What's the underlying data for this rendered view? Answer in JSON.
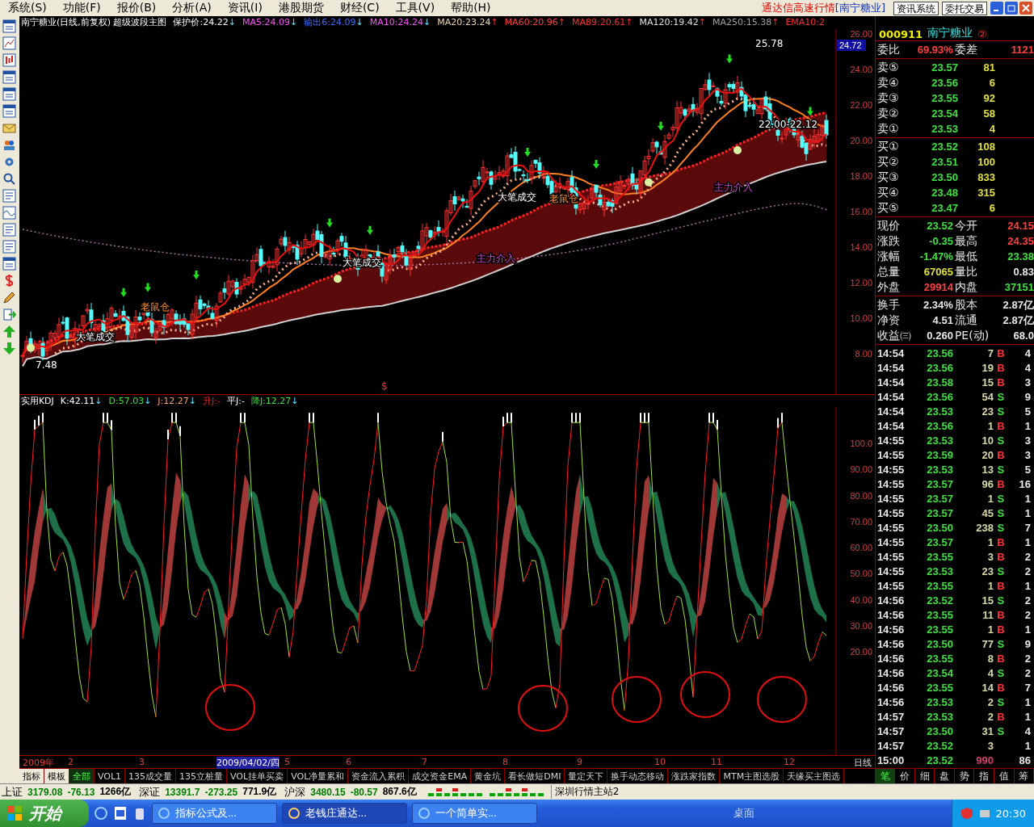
{
  "menu": [
    "系统(S)",
    "功能(F)",
    "报价(B)",
    "分析(A)",
    "资讯(I)",
    "港股期货",
    "财经(C)",
    "工具(V)",
    "帮助(H)"
  ],
  "header": {
    "status": "通达信高速行情",
    "stock": "[南宁糖业]",
    "buttons": [
      "资讯系统",
      "委托交易"
    ]
  },
  "price_pane": {
    "title": "南宁糖业(日线,前复权) 超级波段主图",
    "indicators": [
      {
        "label": "保护价:24.22",
        "arrow": "↓",
        "rising": false,
        "color": "#ffffff"
      },
      {
        "label": "MA5:24.09",
        "arrow": "↓",
        "rising": false,
        "color": "#ff50ff"
      },
      {
        "label": "输出6:24.09",
        "arrow": "↓",
        "rising": false,
        "color": "#3c6cff"
      },
      {
        "label": "MA10:24.24",
        "arrow": "↓",
        "rising": false,
        "color": "#ff50ff"
      },
      {
        "label": "MA20:23.24",
        "arrow": "↑",
        "rising": true,
        "color": "#f0d8b0"
      },
      {
        "label": "MA60:20.96",
        "arrow": "↑",
        "rising": true,
        "color": "#ff4040"
      },
      {
        "label": "MA89:20.61",
        "arrow": "↑",
        "rising": true,
        "color": "#ff3030"
      },
      {
        "label": "MA120:19.42",
        "arrow": "↑",
        "rising": true,
        "color": "#e0e0e0"
      },
      {
        "label": "MA250:15.38",
        "arrow": "↑",
        "rising": true,
        "color": "#a0a0a0"
      },
      {
        "label": "EMA10:2",
        "color": "#ff3030"
      }
    ],
    "axis": [
      "26.00",
      "24.00",
      "22.00",
      "20.00",
      "18.00",
      "16.00",
      "14.00",
      "12.00",
      "10.00",
      "8.00"
    ],
    "current_price": "24.72",
    "annotations": [
      {
        "text": "25.78",
        "kind": "price"
      },
      {
        "text": "22.00-22.12",
        "kind": "price"
      },
      {
        "text": "7.48",
        "kind": "price"
      },
      {
        "text": "大笔成交",
        "kind": "big_trade"
      },
      {
        "text": "大笔成交",
        "kind": "big_trade"
      },
      {
        "text": "大笔成交",
        "kind": "big_trade"
      },
      {
        "text": "老鼠仓",
        "kind": "rat"
      },
      {
        "text": "老鼠仓",
        "kind": "rat"
      },
      {
        "text": "主力介入",
        "kind": "main"
      },
      {
        "text": "主力介入",
        "kind": "main"
      },
      {
        "text": "$",
        "kind": "marker"
      }
    ]
  },
  "kdj_pane": {
    "indicators": [
      {
        "label": "实用KDJ"
      },
      {
        "label": "K:42.11",
        "arrow": "↓",
        "rising": false
      },
      {
        "label": "D:57.03",
        "arrow": "↓",
        "rising": false,
        "color": "#40e040"
      },
      {
        "label": "J:12.27",
        "arrow": "↓",
        "rising": false,
        "color": "#f0a070"
      },
      {
        "label": "升J:-",
        "color": "#e02020"
      },
      {
        "label": "平J:-"
      },
      {
        "label": "降J:12.27",
        "arrow": "↓",
        "rising": false,
        "color": "#40e040"
      }
    ],
    "axis": [
      "100.0",
      "90.00",
      "80.00",
      "70.00",
      "60.00",
      "50.00",
      "40.00",
      "30.00",
      "20.00"
    ]
  },
  "date_axis": {
    "labels": [
      {
        "text": "2009年",
        "selected": false
      },
      {
        "text": "2",
        "selected": false
      },
      {
        "text": "3",
        "selected": false
      },
      {
        "text": "2009/04/02/四",
        "selected": true
      },
      {
        "text": "5",
        "selected": false
      },
      {
        "text": "6",
        "selected": false
      },
      {
        "text": "7",
        "selected": false
      },
      {
        "text": "8",
        "selected": false
      },
      {
        "text": "9",
        "selected": false
      },
      {
        "text": "10",
        "selected": false
      },
      {
        "text": "11",
        "selected": false
      },
      {
        "text": "12",
        "selected": false
      }
    ],
    "period": "日线"
  },
  "mode_buttons": [
    "指标",
    "模板"
  ],
  "tabs": [
    {
      "label": "全部",
      "selected": true
    },
    {
      "label": "VOL1",
      "selected": false
    },
    {
      "label": "135成交量",
      "selected": false
    },
    {
      "label": "135立桩量",
      "selected": false
    },
    {
      "label": "VOL挂单买卖",
      "selected": false
    },
    {
      "label": "VOL净量累和",
      "selected": false
    },
    {
      "label": "资金流入累积",
      "selected": false
    },
    {
      "label": "成交资金EMA",
      "selected": false
    },
    {
      "label": "黄金坑",
      "selected": false
    },
    {
      "label": "看长做短DMI",
      "selected": false
    },
    {
      "label": "量定天下",
      "selected": false
    },
    {
      "label": "换手动态移动",
      "selected": false
    },
    {
      "label": "涨跌家指数",
      "selected": false
    },
    {
      "label": "MTM主图选股",
      "selected": false
    },
    {
      "label": "天缘买主图选",
      "selected": false
    }
  ],
  "quote": {
    "code": "000911",
    "name": "南宁糖业",
    "badge": "②",
    "ratio": {
      "label": "委比",
      "value": "69.93%",
      "label2": "委差",
      "value2": "1121"
    },
    "asks": [
      {
        "label": "卖⑤",
        "price": "23.57",
        "volume": "81"
      },
      {
        "label": "卖④",
        "price": "23.56",
        "volume": "6"
      },
      {
        "label": "卖③",
        "price": "23.55",
        "volume": "92"
      },
      {
        "label": "卖②",
        "price": "23.54",
        "volume": "58"
      },
      {
        "label": "卖①",
        "price": "23.53",
        "volume": "4"
      }
    ],
    "bids": [
      {
        "label": "买①",
        "price": "23.52",
        "volume": "108"
      },
      {
        "label": "买②",
        "price": "23.51",
        "volume": "100"
      },
      {
        "label": "买③",
        "price": "23.50",
        "volume": "833"
      },
      {
        "label": "买④",
        "price": "23.48",
        "volume": "315"
      },
      {
        "label": "买⑤",
        "price": "23.47",
        "volume": "6"
      }
    ],
    "stats": [
      {
        "label": "现价",
        "value": "23.52",
        "color": "#40e040"
      },
      {
        "label": "今开",
        "value": "24.15",
        "color": "#ff4040"
      },
      {
        "label": "涨跌",
        "value": "-0.35",
        "color": "#40e040"
      },
      {
        "label": "最高",
        "value": "24.35",
        "color": "#ff4040"
      },
      {
        "label": "涨幅",
        "value": "-1.47%",
        "color": "#40e040"
      },
      {
        "label": "最低",
        "value": "23.38",
        "color": "#40e040"
      },
      {
        "label": "总量",
        "value": "67065",
        "color": "#e0e040"
      },
      {
        "label": "量比",
        "value": "0.83",
        "color": "#e8e8e8"
      },
      {
        "label": "外盘",
        "value": "29914",
        "color": "#ff4040"
      },
      {
        "label": "内盘",
        "value": "37151",
        "color": "#40e040"
      }
    ],
    "finance": [
      {
        "label": "换手",
        "value": "2.34%",
        "label2": "股本",
        "value2": "2.87亿"
      },
      {
        "label": "净资",
        "value": "4.51",
        "label2": "流通",
        "value2": "2.87亿"
      },
      {
        "label": "收益㈢",
        "value": "0.260",
        "label2": "PE(动)",
        "value2": "68.0"
      }
    ]
  },
  "ticks": [
    {
      "time": "14:54",
      "price": "23.56",
      "volume": "7",
      "side": "B",
      "kind": "buy",
      "count": "4",
      "large": false
    },
    {
      "time": "14:54",
      "price": "23.56",
      "volume": "19",
      "side": "B",
      "kind": "buy",
      "count": "4",
      "large": false
    },
    {
      "time": "14:54",
      "price": "23.58",
      "volume": "15",
      "side": "B",
      "kind": "buy",
      "count": "3",
      "large": false
    },
    {
      "time": "14:54",
      "price": "23.56",
      "volume": "54",
      "side": "S",
      "kind": "sell",
      "count": "9",
      "large": false
    },
    {
      "time": "14:54",
      "price": "23.53",
      "volume": "23",
      "side": "S",
      "kind": "sell",
      "count": "5",
      "large": false
    },
    {
      "time": "14:54",
      "price": "23.56",
      "volume": "1",
      "side": "B",
      "kind": "buy",
      "count": "1",
      "large": false
    },
    {
      "time": "14:55",
      "price": "23.53",
      "volume": "10",
      "side": "S",
      "kind": "sell",
      "count": "3",
      "large": false
    },
    {
      "time": "14:55",
      "price": "23.59",
      "volume": "20",
      "side": "B",
      "kind": "buy",
      "count": "3",
      "large": false
    },
    {
      "time": "14:55",
      "price": "23.53",
      "volume": "13",
      "side": "S",
      "kind": "sell",
      "count": "5",
      "large": false
    },
    {
      "time": "14:55",
      "price": "23.57",
      "volume": "96",
      "side": "B",
      "kind": "buy",
      "count": "16",
      "large": false
    },
    {
      "time": "14:55",
      "price": "23.57",
      "volume": "1",
      "side": "S",
      "kind": "sell",
      "count": "1",
      "large": false
    },
    {
      "time": "14:55",
      "price": "23.57",
      "volume": "45",
      "side": "S",
      "kind": "sell",
      "count": "1",
      "large": false
    },
    {
      "time": "14:55",
      "price": "23.50",
      "volume": "238",
      "side": "S",
      "kind": "sell",
      "count": "7",
      "large": false
    },
    {
      "time": "14:55",
      "price": "23.57",
      "volume": "1",
      "side": "B",
      "kind": "buy",
      "count": "1",
      "large": false
    },
    {
      "time": "14:55",
      "price": "23.55",
      "volume": "3",
      "side": "B",
      "kind": "buy",
      "count": "2",
      "large": false
    },
    {
      "time": "14:55",
      "price": "23.53",
      "volume": "23",
      "side": "S",
      "kind": "sell",
      "count": "2",
      "large": false
    },
    {
      "time": "14:55",
      "price": "23.55",
      "volume": "1",
      "side": "B",
      "kind": "buy",
      "count": "1",
      "large": false
    },
    {
      "time": "14:56",
      "price": "23.52",
      "volume": "15",
      "side": "S",
      "kind": "sell",
      "count": "2",
      "large": false
    },
    {
      "time": "14:56",
      "price": "23.55",
      "volume": "11",
      "side": "B",
      "kind": "buy",
      "count": "2",
      "large": false
    },
    {
      "time": "14:56",
      "price": "23.55",
      "volume": "1",
      "side": "B",
      "kind": "buy",
      "count": "1",
      "large": false
    },
    {
      "time": "14:56",
      "price": "23.50",
      "volume": "77",
      "side": "S",
      "kind": "sell",
      "count": "9",
      "large": false
    },
    {
      "time": "14:56",
      "price": "23.55",
      "volume": "8",
      "side": "B",
      "kind": "buy",
      "count": "2",
      "large": false
    },
    {
      "time": "14:56",
      "price": "23.54",
      "volume": "4",
      "side": "S",
      "kind": "sell",
      "count": "2",
      "large": false
    },
    {
      "time": "14:56",
      "price": "23.55",
      "volume": "14",
      "side": "B",
      "kind": "buy",
      "count": "7",
      "large": false
    },
    {
      "time": "14:56",
      "price": "23.53",
      "volume": "2",
      "side": "S",
      "kind": "sell",
      "count": "1",
      "large": false
    },
    {
      "time": "14:57",
      "price": "23.53",
      "volume": "2",
      "side": "B",
      "kind": "buy",
      "count": "1",
      "large": false
    },
    {
      "time": "14:57",
      "price": "23.50",
      "volume": "31",
      "side": "S",
      "kind": "sell",
      "count": "4",
      "large": false
    },
    {
      "time": "14:57",
      "price": "23.52",
      "volume": "3",
      "kind": "none",
      "count": "1",
      "large": false
    },
    {
      "time": "15:00",
      "price": "23.52",
      "volume": "990",
      "kind": "none",
      "count": "86",
      "large": true
    }
  ],
  "panel_tabs": [
    {
      "label": "笔",
      "selected": true
    },
    {
      "label": "价",
      "selected": false
    },
    {
      "label": "细",
      "selected": false
    },
    {
      "label": "盘",
      "selected": false
    },
    {
      "label": "势",
      "selected": false
    },
    {
      "label": "指",
      "selected": false
    },
    {
      "label": "值",
      "selected": false
    },
    {
      "label": "筹",
      "selected": false
    }
  ],
  "status_bar": {
    "indices": [
      {
        "name": "上证",
        "value": "3179.08",
        "change": "-76.13",
        "amount": "1266亿",
        "color": "#008000"
      },
      {
        "name": "深证",
        "value": "13391.7",
        "change": "-273.25",
        "amount": "771.9亿",
        "color": "#008000"
      },
      {
        "name": "沪深",
        "value": "3480.15",
        "change": "-80.57",
        "amount": "867.6亿",
        "color": "#008000"
      }
    ],
    "server": "深圳行情主站2"
  },
  "taskbar": {
    "start": "开始",
    "tasks": [
      {
        "label": "指标公式及...",
        "selected": false
      },
      {
        "label": "老钱庄通达...",
        "selected": true
      },
      {
        "label": "一个简单实...",
        "selected": false
      }
    ],
    "desktop": "桌面",
    "clock": "20:30"
  }
}
